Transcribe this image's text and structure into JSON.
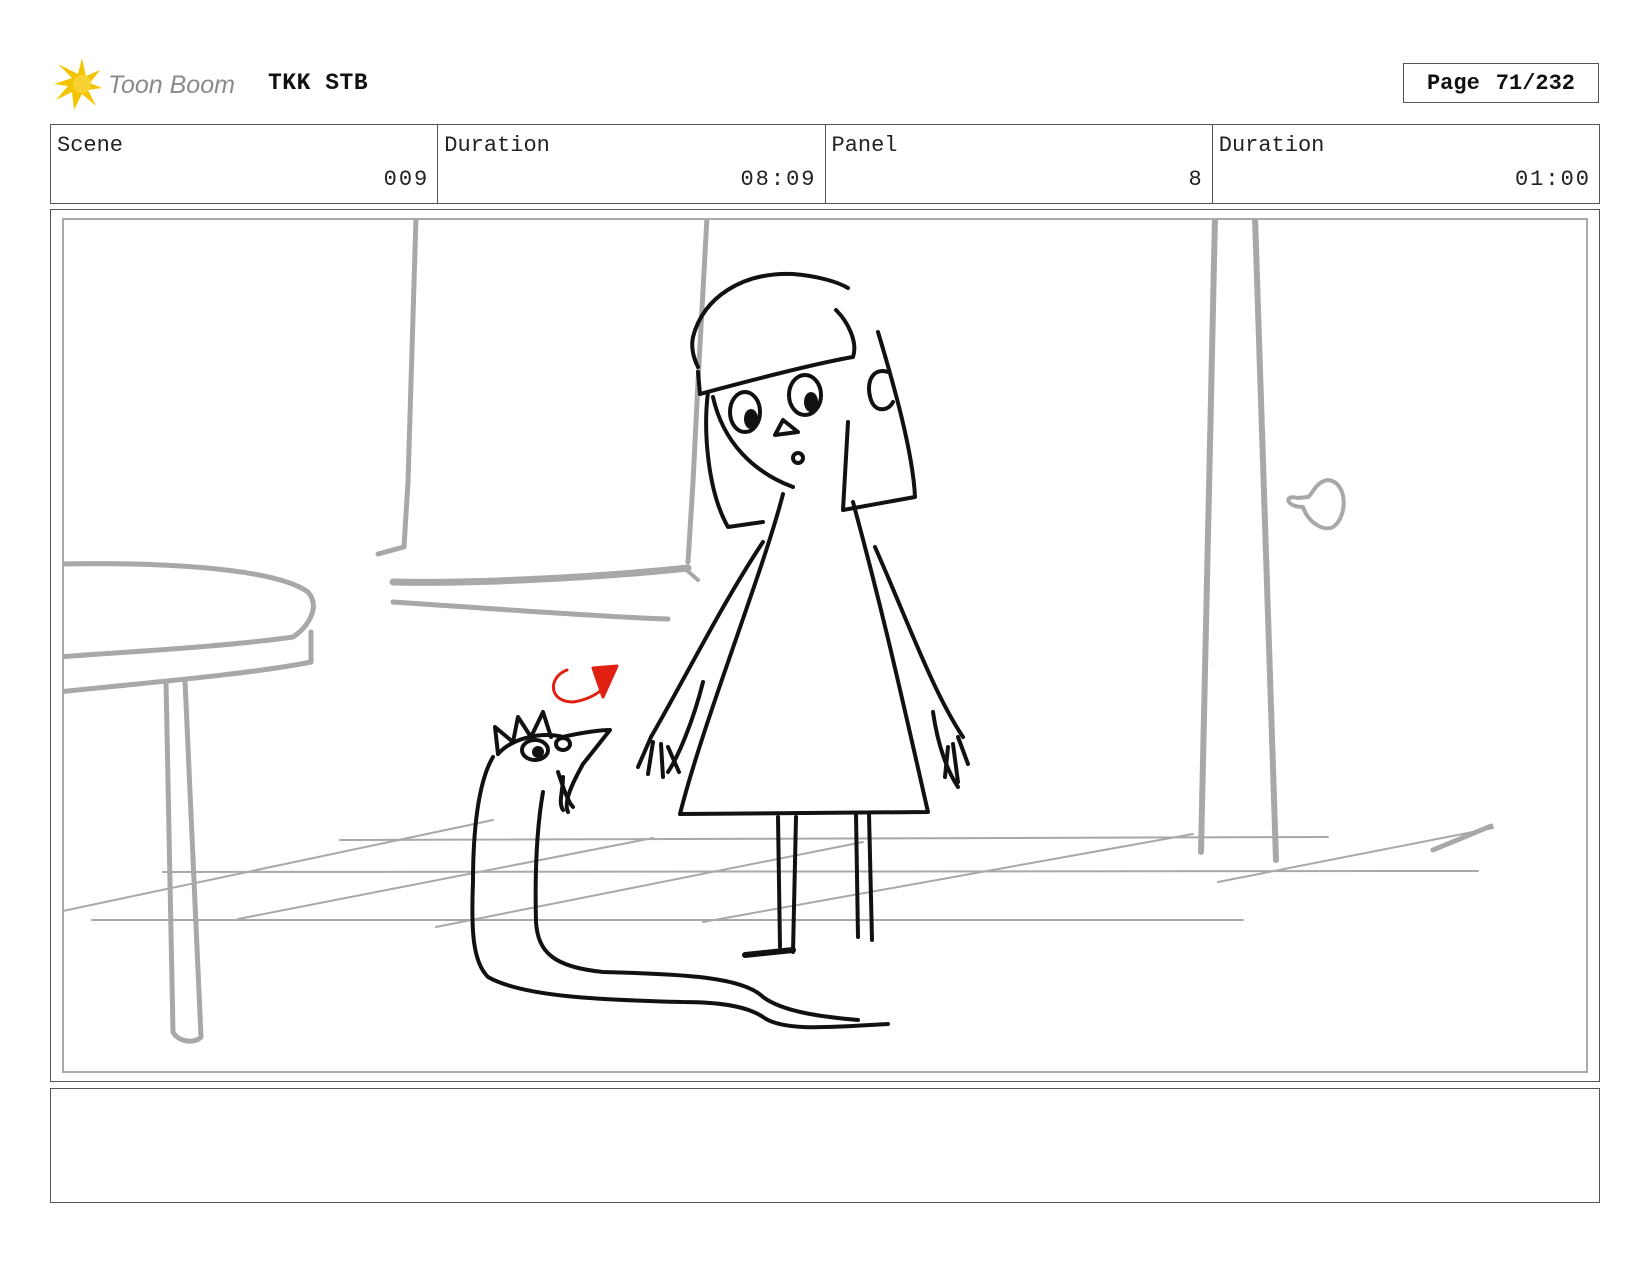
{
  "header": {
    "logo_text": "Toon Boom",
    "project_title": "TKK STB",
    "page_label": "Page",
    "page_value": "71/232"
  },
  "info": {
    "scene_label": "Scene",
    "scene_value": "009",
    "scene_duration_label": "Duration",
    "scene_duration_value": "08:09",
    "panel_label": "Panel",
    "panel_value": "8",
    "panel_duration_label": "Duration",
    "panel_duration_value": "01:00"
  },
  "notes": {
    "text": ""
  },
  "colors": {
    "logo_yellow": "#f5c400",
    "logo_text": "#8a8a8a",
    "sketch_black": "#111111",
    "sketch_gray": "#a8a8a8",
    "annotation_red": "#e02010"
  }
}
